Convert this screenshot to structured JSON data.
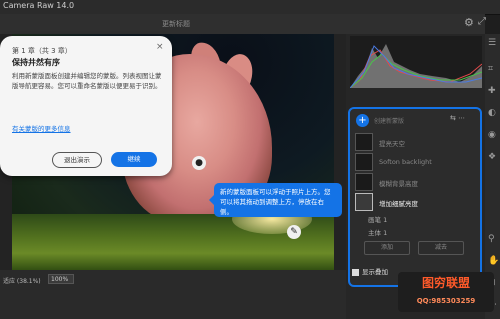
{
  "app": {
    "title": "Camera Raw 14.0"
  },
  "header": {
    "doc_name": "更新标题"
  },
  "dialog": {
    "step": "第 1 章（共 3 章）",
    "title": "保持井然有序",
    "body": "利用新蒙版面板创建并编辑您的蒙版。列表视图让蒙版导航更容易。您可以重命名蒙版以便更易于识别。",
    "link": "有关蒙版的更多信息",
    "exit_button": "退出演示",
    "next_button": "继续",
    "close_glyph": "×"
  },
  "tooltip": {
    "text": "新的蒙版面板可以浮动于照片上方。您可以将其拖动到调整上方，停放在右侧。"
  },
  "bottom": {
    "zoom_label": "适应 (38.1%)",
    "zoom_value": "100%"
  },
  "masks_panel": {
    "header": "创建新蒙版",
    "header_icons": "⇆ ⋯",
    "items": [
      {
        "label": "提亮天空"
      },
      {
        "label": "Softon backlight"
      },
      {
        "label": "模糊背景高度"
      },
      {
        "label": "增加细腻亮度"
      }
    ],
    "sub_items": [
      {
        "label": "画笔 1"
      },
      {
        "label": "主体 1"
      }
    ],
    "add_button": "添加",
    "subtract_button": "减去"
  },
  "overlay": {
    "label": "显示叠加"
  },
  "watermark": {
    "line1": "图穷联盟",
    "line2": "QQ:985303259"
  },
  "colors": {
    "accent": "#1473e6",
    "panel": "#262626",
    "dialog": "#f5f5f5"
  }
}
